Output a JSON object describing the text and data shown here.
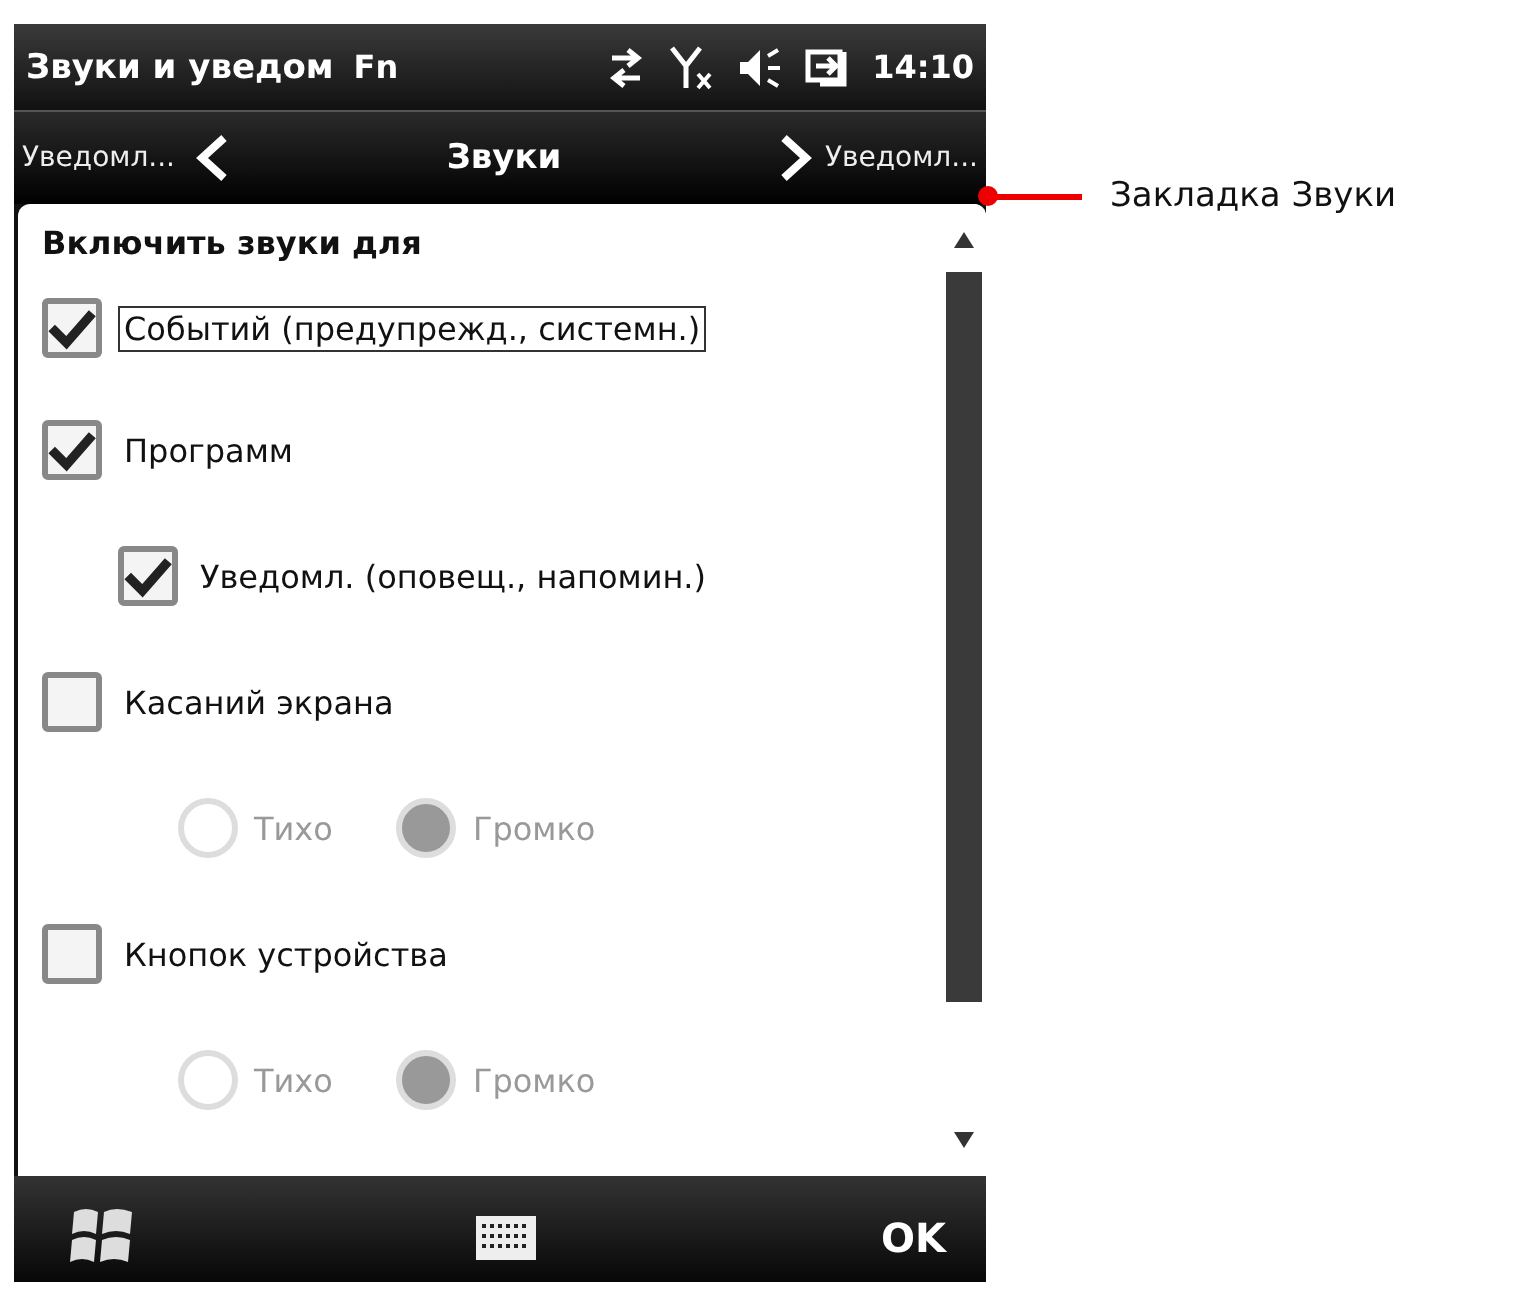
{
  "status_bar": {
    "title": "Звуки и уведом",
    "indicator": "Fn",
    "time": "14:10"
  },
  "tab_bar": {
    "previous": "Уведомл...",
    "current": "Звуки",
    "next": "Уведомл..."
  },
  "section_title": "Включить звуки для",
  "items": [
    {
      "kind": "checkbox",
      "label": "Событий (предупрежд., системн.)",
      "checked": true,
      "focused": true
    },
    {
      "kind": "checkbox",
      "label": "Программ",
      "checked": true,
      "focused": false,
      "children": [
        {
          "kind": "checkbox",
          "label": "Уведомл. (оповещ., напомин.)",
          "checked": true,
          "focused": false
        }
      ]
    },
    {
      "kind": "checkbox",
      "label": "Касаний экрана",
      "checked": false,
      "focused": false,
      "children": [
        {
          "kind": "radio_group",
          "disabled": true,
          "options": [
            {
              "label": "Тихо",
              "selected": false
            },
            {
              "label": "Громко",
              "selected": true
            }
          ]
        }
      ]
    },
    {
      "kind": "checkbox",
      "label": "Кнопок устройства",
      "checked": false,
      "focused": false,
      "children": [
        {
          "kind": "radio_group",
          "disabled": true,
          "options": [
            {
              "label": "Тихо",
              "selected": false
            },
            {
              "label": "Громко",
              "selected": true
            }
          ]
        }
      ]
    }
  ],
  "softkeys": {
    "right": "OK"
  },
  "annotation": {
    "label": "Закладка Звуки"
  }
}
